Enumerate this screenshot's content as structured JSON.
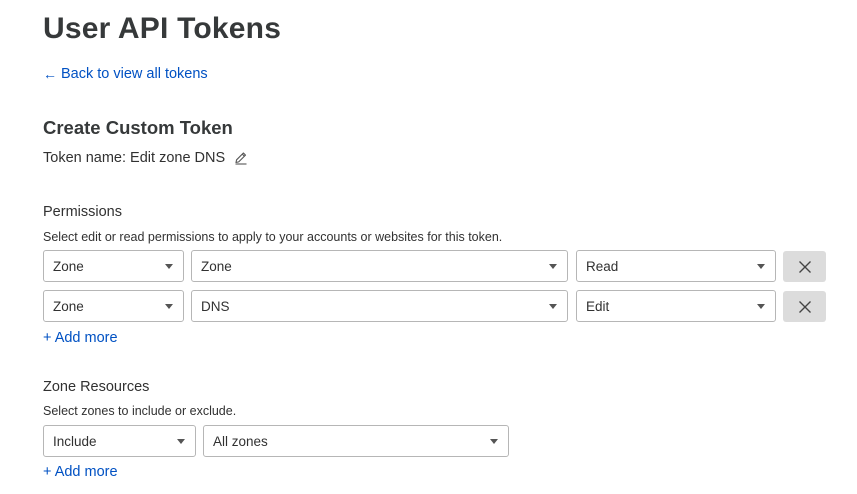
{
  "page": {
    "title": "User API Tokens",
    "back_link": {
      "arrow": "←",
      "label": "Back to view all tokens"
    }
  },
  "token": {
    "section_title": "Create Custom Token",
    "name_text": "Token name: Edit zone DNS",
    "edit_icon": "pencil-icon"
  },
  "permissions": {
    "label": "Permissions",
    "description": "Select edit or read permissions to apply to your accounts or websites for this token.",
    "rows": [
      {
        "scope": "Zone",
        "resource": "Zone",
        "access": "Read"
      },
      {
        "scope": "Zone",
        "resource": "DNS",
        "access": "Edit"
      }
    ],
    "remove_icon": "close-icon",
    "add_more": "+ Add more"
  },
  "zone_resources": {
    "label": "Zone Resources",
    "description": "Select zones to include or exclude.",
    "include_select": "Include",
    "zones_select": "All zones",
    "add_more": "+ Add more"
  },
  "colors": {
    "link": "#0051c3",
    "text": "#313131",
    "heading": "#36393a",
    "remove_button_bg": "#dcdcdc",
    "select_border": "#b6b6b6"
  }
}
